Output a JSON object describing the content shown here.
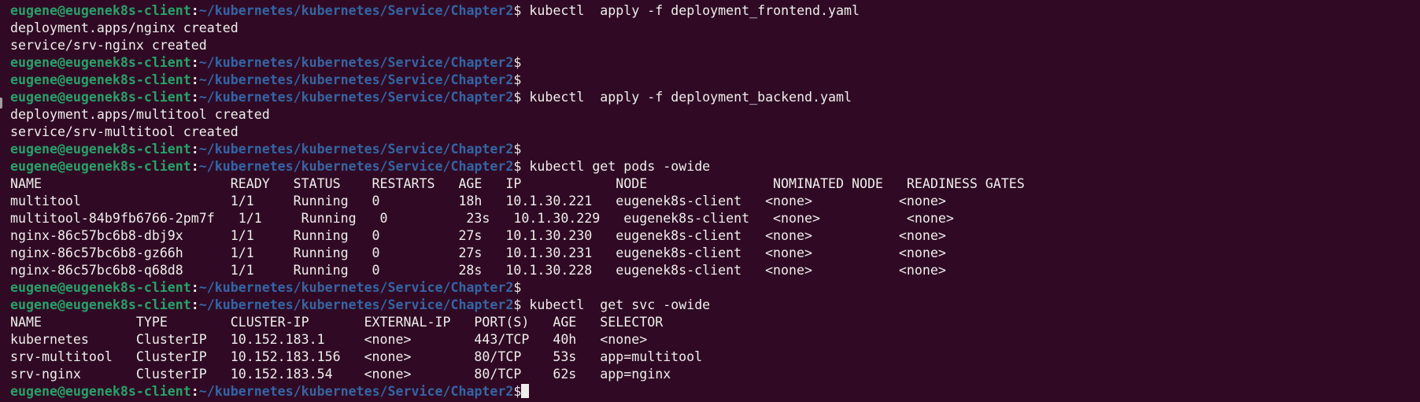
{
  "prompt": {
    "user_host": "eugene@eugenek8s-client",
    "separator": ":",
    "path": "~/kubernetes/kubernetes/Service/Chapter2",
    "symbol": "$"
  },
  "colors": {
    "background": "#300a24",
    "user_host": "#26a269",
    "path": "#3465a4",
    "text": "#eeeeec"
  },
  "lines": [
    {
      "type": "prompt",
      "cmd": " kubectl  apply -f deployment_frontend.yaml"
    },
    {
      "type": "output",
      "text": "deployment.apps/nginx created"
    },
    {
      "type": "output",
      "text": "service/srv-nginx created"
    },
    {
      "type": "prompt",
      "cmd": ""
    },
    {
      "type": "prompt",
      "cmd": ""
    },
    {
      "type": "prompt",
      "cmd": " kubectl  apply -f deployment_backend.yaml"
    },
    {
      "type": "output",
      "text": "deployment.apps/multitool created"
    },
    {
      "type": "output",
      "text": "service/srv-multitool created"
    },
    {
      "type": "prompt",
      "cmd": ""
    },
    {
      "type": "prompt",
      "cmd": " kubectl get pods -owide"
    },
    {
      "type": "output",
      "text": "NAME                        READY   STATUS    RESTARTS   AGE   IP            NODE                NOMINATED NODE   READINESS GATES"
    },
    {
      "type": "output",
      "text": "multitool                   1/1     Running   0          18h   10.1.30.221   eugenek8s-client   <none>           <none>"
    },
    {
      "type": "output",
      "text": "multitool-84b9fb6766-2pm7f   1/1     Running   0          23s   10.1.30.229   eugenek8s-client   <none>           <none>"
    },
    {
      "type": "output",
      "text": "nginx-86c57bc6b8-dbj9x      1/1     Running   0          27s   10.1.30.230   eugenek8s-client   <none>           <none>"
    },
    {
      "type": "output",
      "text": "nginx-86c57bc6b8-gz66h      1/1     Running   0          27s   10.1.30.231   eugenek8s-client   <none>           <none>"
    },
    {
      "type": "output",
      "text": "nginx-86c57bc6b8-q68d8      1/1     Running   0          28s   10.1.30.228   eugenek8s-client   <none>           <none>"
    },
    {
      "type": "prompt",
      "cmd": ""
    },
    {
      "type": "prompt",
      "cmd": " kubectl  get svc -owide"
    },
    {
      "type": "output",
      "text": "NAME            TYPE        CLUSTER-IP       EXTERNAL-IP   PORT(S)   AGE   SELECTOR"
    },
    {
      "type": "output",
      "text": "kubernetes      ClusterIP   10.152.183.1     <none>        443/TCP   40h   <none>"
    },
    {
      "type": "output",
      "text": "srv-multitool   ClusterIP   10.152.183.156   <none>        80/TCP    53s   app=multitool"
    },
    {
      "type": "output",
      "text": "srv-nginx       ClusterIP   10.152.183.54    <none>        80/TCP    62s   app=nginx"
    },
    {
      "type": "prompt",
      "cmd": "",
      "cursor": true
    }
  ]
}
